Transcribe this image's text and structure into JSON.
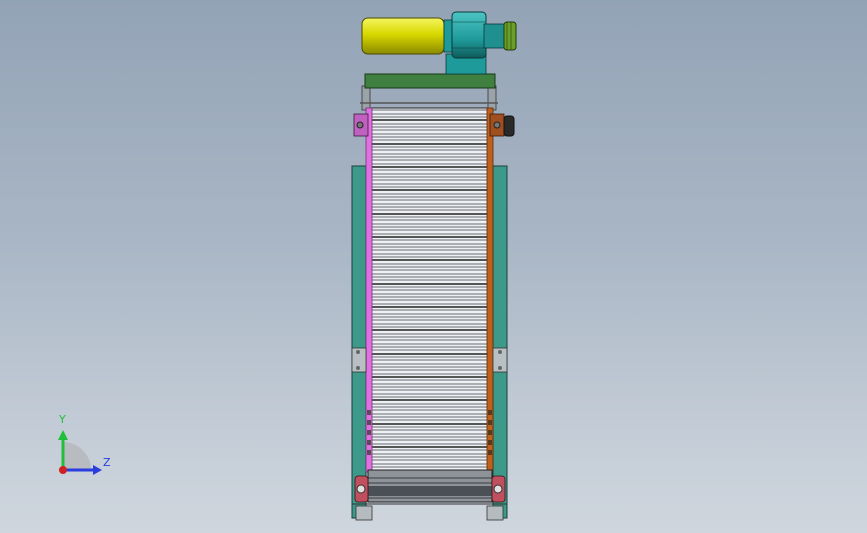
{
  "triad": {
    "y_label": "Y",
    "z_label": "Z"
  },
  "colors": {
    "motor_yellow": "#d8d800",
    "gearbox_teal": "#1f9a9a",
    "top_plate_green": "#3f7f3f",
    "frame_teal": "#3d9a8a",
    "left_chain_pink": "#e070e0",
    "right_chain_orange": "#c0601a",
    "screen_bars": "#ffffff",
    "axis_y": "#1fbf3a",
    "axis_z": "#2a3de0",
    "axis_origin": "#d02020"
  }
}
